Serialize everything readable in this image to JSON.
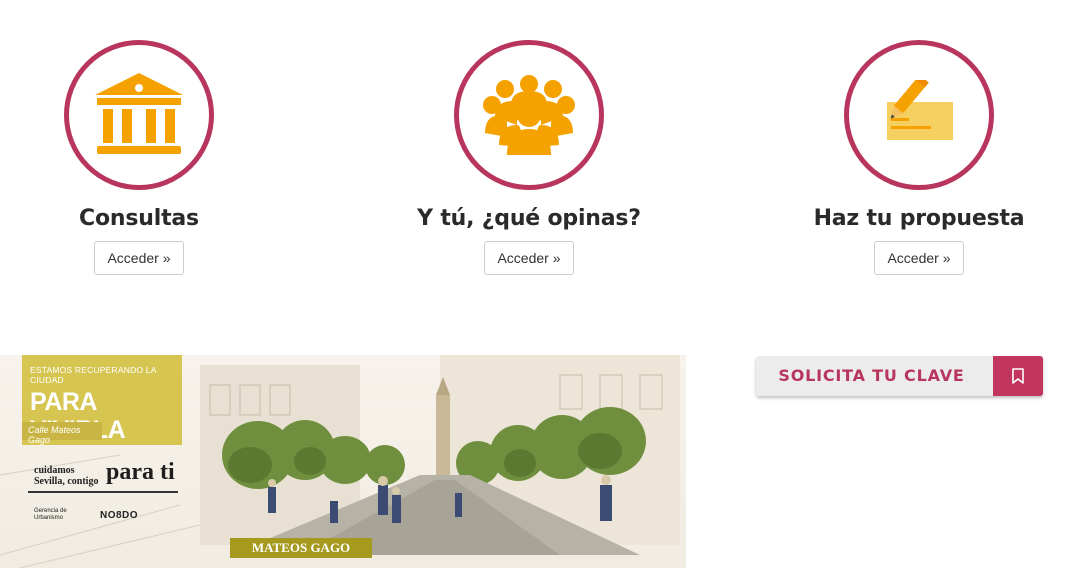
{
  "features": [
    {
      "title": "Consultas",
      "button": "Acceder »",
      "icon": "institution-icon"
    },
    {
      "title": "Y tú, ¿qué opinas?",
      "button": "Acceder »",
      "icon": "group-icon"
    },
    {
      "title": "Haz tu propuesta",
      "button": "Acceder »",
      "icon": "pencil-icon"
    }
  ],
  "banner": {
    "tagline_small": "ESTAMOS RECUPERANDO LA CIUDAD",
    "tagline_big": "PARA VIVIRLA",
    "street_sub": "Calle Mateos Gago",
    "slogan_small": "cuidamos Sevilla, contigo",
    "slogan_big": "para ti",
    "logo_left": "Gerencia de Urbanismo",
    "logo_right": "NO8DO",
    "street_tag": "MATEOS GAGO"
  },
  "clave": {
    "label": "SOLICITA TU CLAVE",
    "icon": "bookmark-icon"
  },
  "colors": {
    "accent": "#b8365e",
    "icon": "#f5a100",
    "banner_label": "#d7c552",
    "street_tag": "#a59a1e"
  }
}
